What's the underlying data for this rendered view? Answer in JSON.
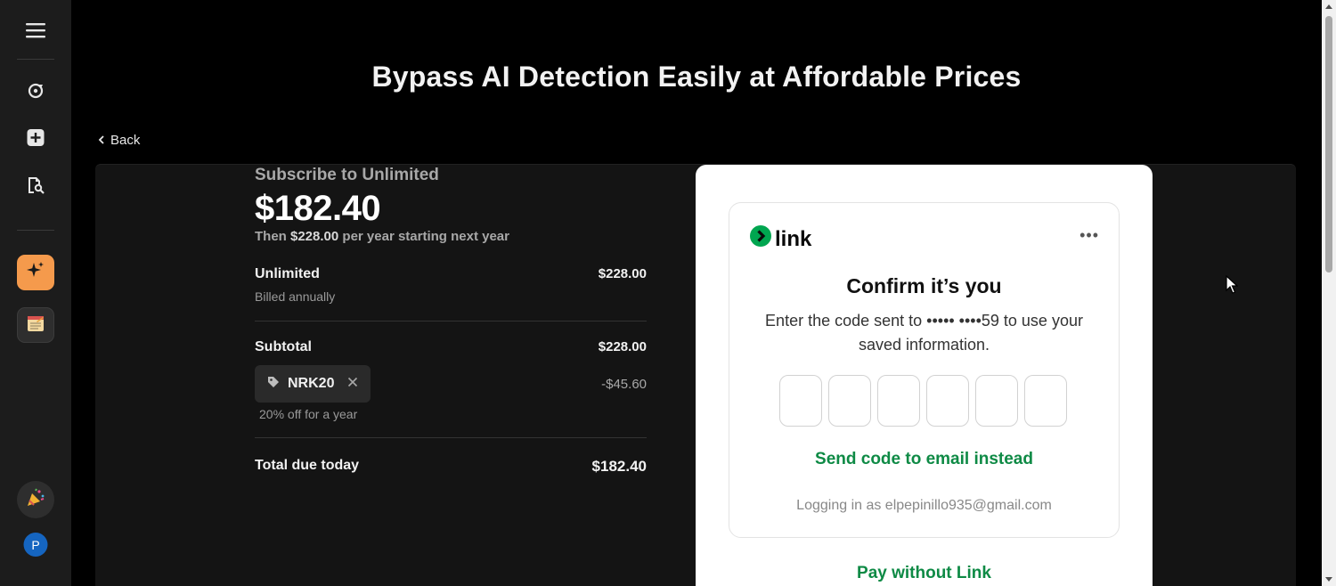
{
  "sidebar": {
    "icons": [
      "menu-icon",
      "refresh-icon",
      "plus-icon",
      "search-doc-icon",
      "sparkle-icon",
      "notepad-icon",
      "party-icon"
    ],
    "avatar_letter": "P",
    "colors": {
      "bg": "#1c1c1c",
      "active_tile": "#f59a4c",
      "avatar": "#1565c0"
    }
  },
  "page": {
    "title": "Bypass AI Detection Easily at Affordable Prices",
    "back_label": "Back"
  },
  "summary": {
    "subscribe_title": "Subscribe to Unlimited",
    "price": "$182.40",
    "then_prefix": "Then ",
    "then_amount": "$228.00",
    "then_suffix": " per year starting next year",
    "item_name": "Unlimited",
    "item_amount": "$228.00",
    "item_billing": "Billed annually",
    "subtotal_label": "Subtotal",
    "subtotal_amount": "$228.00",
    "promo_code": "NRK20",
    "promo_discount": "-$45.60",
    "promo_desc": "20% off for a year",
    "total_label": "Total due today",
    "total_amount": "$182.40"
  },
  "link": {
    "brand": "link",
    "more_menu": "•••",
    "confirm_title": "Confirm it’s you",
    "description": "Enter the code sent to ••••• ••••59 to use your saved information.",
    "send_email": "Send code to email instead",
    "logged_in_as": "Logging in as elpepinillo935@gmail.com",
    "pay_without": "Pay without Link",
    "accent": "#0e8a45"
  }
}
